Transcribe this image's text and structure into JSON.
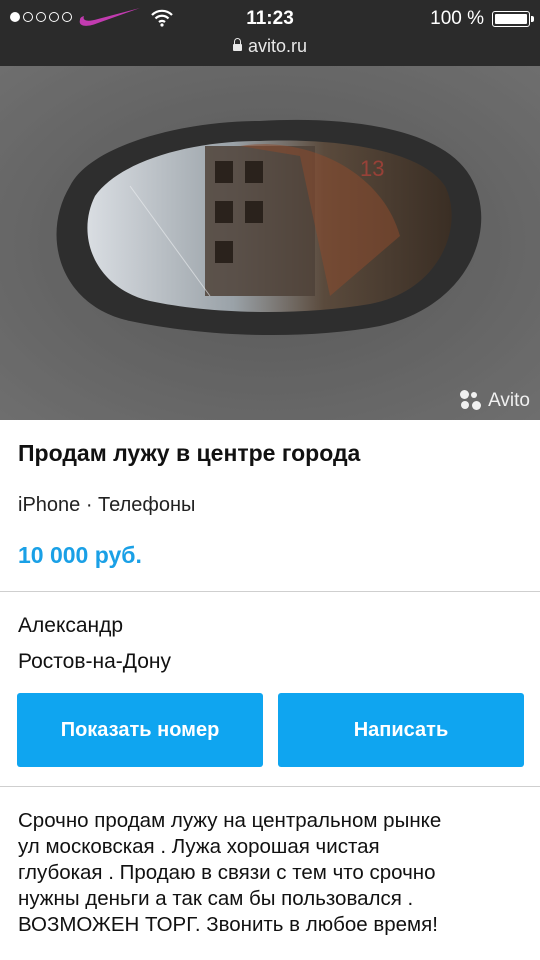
{
  "status_bar": {
    "time": "11:23",
    "battery": "100 %",
    "signal_bars_on": 1,
    "signal_bars_total": 5
  },
  "browser": {
    "url": "avito.ru"
  },
  "photo": {
    "watermark": "Avito"
  },
  "listing": {
    "title": "Продам лужу в центре города",
    "category": "iPhone · Телефоны",
    "price": "10 000 руб.",
    "seller_name": "Александр",
    "city": "Ростов-на-Дону",
    "show_phone_label": "Показать номер",
    "write_label": "Написать",
    "description_lines": [
      "Срочно продам лужу на центральном рынке",
      "ул московская . Лужа хорошая чистая",
      "глубокая . Продаю в связи с тем что срочно",
      "нужны деньги а так сам бы пользовался .",
      "ВОЗМОЖЕН ТОРГ. Звонить в любое время!"
    ]
  },
  "colors": {
    "accent": "#0fa5f0",
    "price": "#1aa0e6",
    "topbar": "#2b2b2b",
    "swoosh": "#c23bb0"
  },
  "icons": [
    "signal-dots-icon",
    "nike-swoosh-icon",
    "wifi-icon",
    "battery-icon",
    "lock-icon",
    "avito-logo-icon"
  ]
}
